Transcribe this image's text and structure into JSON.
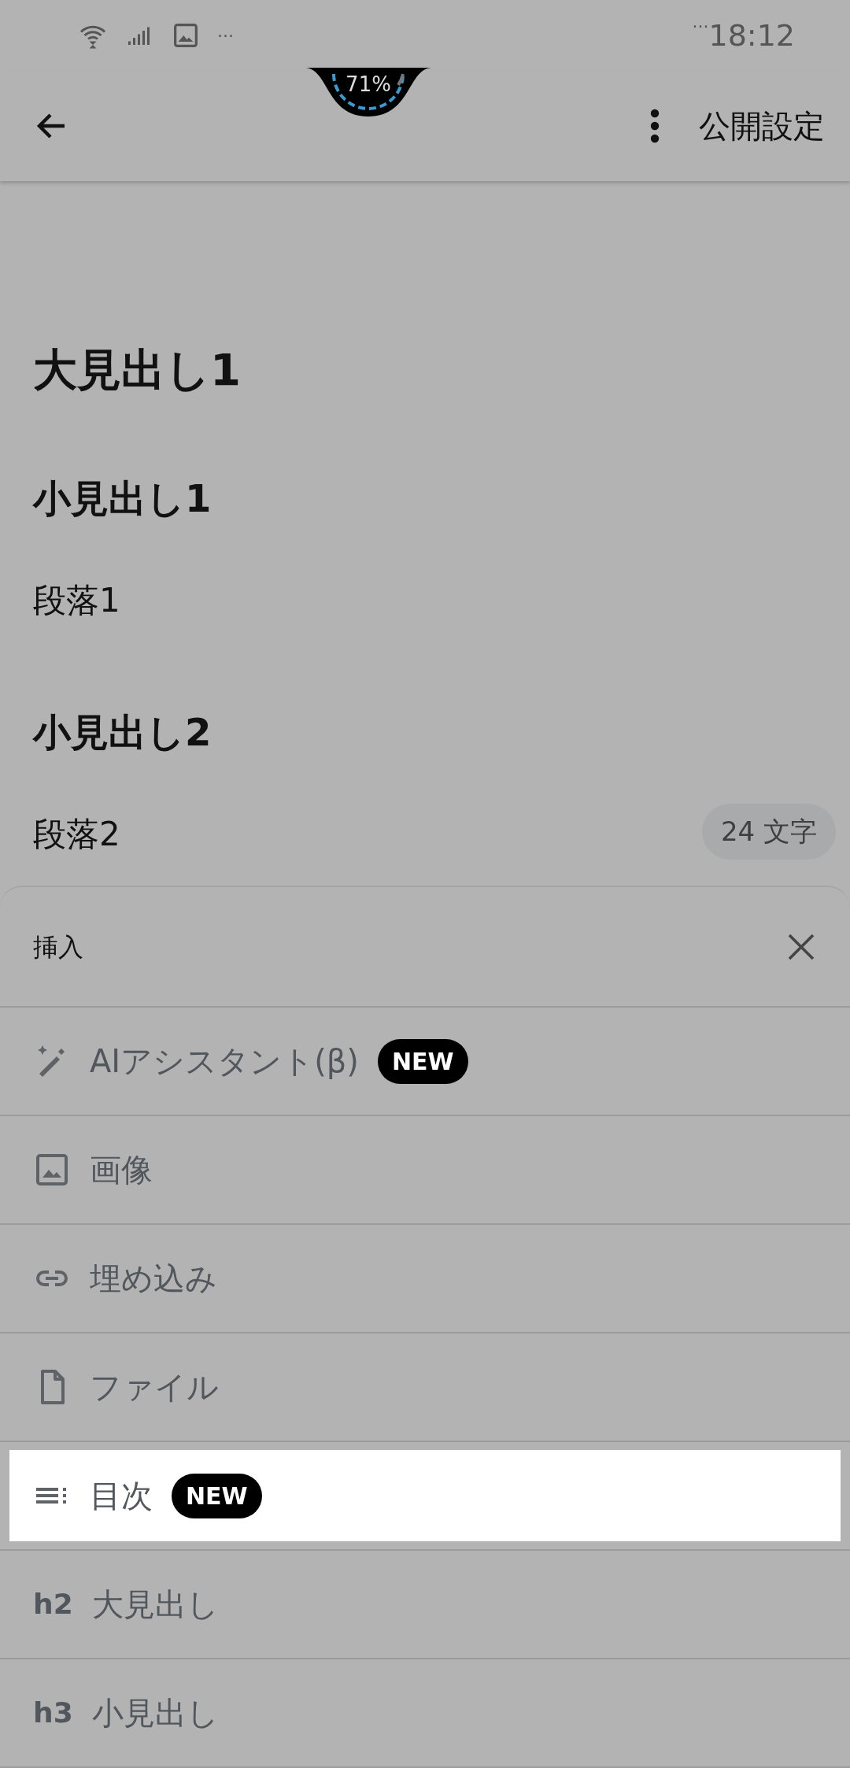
{
  "status_bar": {
    "left_extra": "···",
    "time_prefix": "···",
    "time": "18:12",
    "battery": "71%"
  },
  "app_bar": {
    "action": "公開設定"
  },
  "editor": {
    "blocks": [
      {
        "kind": "h2",
        "text": "大見出し1"
      },
      {
        "kind": "h3",
        "text": "小見出し1"
      },
      {
        "kind": "p",
        "text": "段落1"
      },
      {
        "kind": "h3",
        "text": "小見出し2"
      },
      {
        "kind": "p",
        "text": "段落2"
      }
    ],
    "char_count": "24 文字"
  },
  "insert_sheet": {
    "title": "挿入",
    "items": [
      {
        "kind": "ai",
        "label": "AIアシスタント(β)",
        "badge": "NEW",
        "selected": false
      },
      {
        "kind": "image",
        "label": "画像",
        "selected": false
      },
      {
        "kind": "embed",
        "label": "埋め込み",
        "selected": false
      },
      {
        "kind": "file",
        "label": "ファイル",
        "selected": false
      },
      {
        "kind": "toc",
        "label": "目次",
        "badge": "NEW",
        "selected": true
      },
      {
        "kind": "heading",
        "icon_text": "h2",
        "label": "大見出し",
        "selected": false
      },
      {
        "kind": "heading",
        "icon_text": "h3",
        "label": "小見出し",
        "selected": false
      }
    ]
  }
}
